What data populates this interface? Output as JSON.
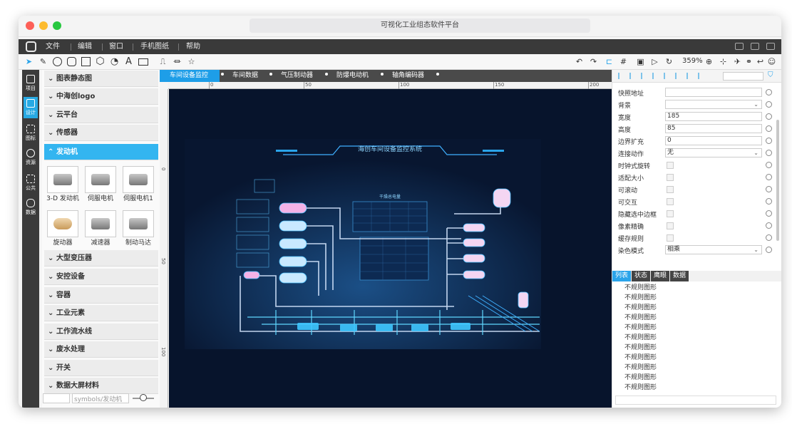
{
  "window": {
    "title": "可视化工业组态软件平台"
  },
  "menu": [
    "文件",
    "编辑",
    "窗口",
    "手机图纸",
    "帮助"
  ],
  "toolbar": {
    "zoom": "359%"
  },
  "leftnav": [
    {
      "label": "项目",
      "icon": "chart-icon"
    },
    {
      "label": "设计",
      "icon": "design-icon"
    },
    {
      "label": "图标",
      "icon": "grid-icon"
    },
    {
      "label": "资源",
      "icon": "cloud-upload-icon"
    },
    {
      "label": "公共",
      "icon": "grid-icon"
    },
    {
      "label": "数据",
      "icon": "database-icon"
    }
  ],
  "categories_top": [
    "图表静态图",
    "中海创logo",
    "云平台",
    "传感器"
  ],
  "active_category": "发动机",
  "thumbs": [
    "3-D 发动机",
    "伺服电机",
    "伺服电机1",
    "旋动器",
    "减速器",
    "制动马达"
  ],
  "categories_bottom": [
    "大型变压器",
    "安控设备",
    "容器",
    "工业元素",
    "工作流水线",
    "废水处理",
    "开关",
    "数据大屏材料"
  ],
  "symbol_path": "symbols/发动机",
  "tabs": [
    "车间设备监控",
    "车间数据",
    "气压制动器",
    "防爆电动机",
    "轴角编码器"
  ],
  "ruler_top": [
    "0",
    "50",
    "100",
    "150",
    "200"
  ],
  "ruler_left": [
    "0",
    "50",
    "100"
  ],
  "scada": {
    "title": "海创车间设备监控系统",
    "table_title": "干燥总电量"
  },
  "props": [
    {
      "label": "快照地址",
      "type": "input",
      "value": ""
    },
    {
      "label": "背景",
      "type": "select",
      "value": ""
    },
    {
      "label": "宽度",
      "type": "input",
      "value": "185"
    },
    {
      "label": "高度",
      "type": "input",
      "value": "85"
    },
    {
      "label": "边界扩充",
      "type": "input",
      "value": "0"
    },
    {
      "label": "连接动作",
      "type": "select",
      "value": "无"
    },
    {
      "label": "时钟式旋转",
      "type": "check",
      "value": ""
    },
    {
      "label": "适配大小",
      "type": "check",
      "value": ""
    },
    {
      "label": "可滚动",
      "type": "check",
      "value": ""
    },
    {
      "label": "可交互",
      "type": "check",
      "value": ""
    },
    {
      "label": "隐藏选中边框",
      "type": "check",
      "value": ""
    },
    {
      "label": "像素精确",
      "type": "check",
      "value": ""
    },
    {
      "label": "缓存规则",
      "type": "check",
      "value": ""
    },
    {
      "label": "染色模式",
      "type": "select",
      "value": "相乘"
    }
  ],
  "list_tabs": [
    "列表",
    "状态",
    "鹰眼",
    "数据"
  ],
  "list_items": [
    "不规则图形",
    "不规则图形",
    "不规则图形",
    "不规则图形",
    "不规则图形",
    "不规则图形",
    "不规则图形",
    "不规则图形",
    "不规则图形",
    "不规则图形",
    "不规则图形",
    "不规则图形",
    "不规则图形",
    "不规则图形",
    "不规则图形",
    "不规则图形",
    "不规则图形",
    "不规则图形",
    "不规则图形",
    "不规则图形",
    "不规则图形",
    "不规则图形",
    "不规则图形",
    "不规则图形"
  ]
}
